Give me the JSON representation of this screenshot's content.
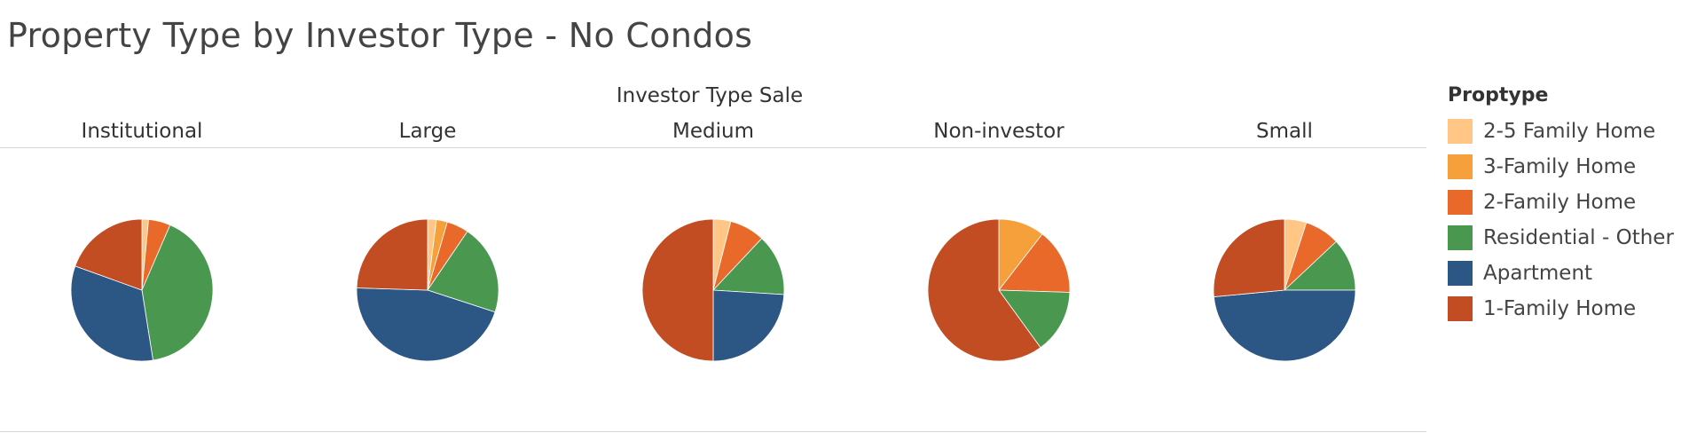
{
  "title": "Property Type by Investor Type - No Condos",
  "chart_data": {
    "type": "pie",
    "title": "Property Type by Investor Type - No Condos",
    "facet_label": "Investor Type Sale",
    "legend_title": "Proptype",
    "legend_position": "right",
    "categories": [
      "2-5 Family Home",
      "3-Family Home",
      "2-Family Home",
      "Residential - Other",
      "Apartment",
      "1-Family Home"
    ],
    "colors": [
      "#FFC685",
      "#F5A03A",
      "#E8692A",
      "#4A9850",
      "#2C5784",
      "#C34D23"
    ],
    "panels": [
      {
        "name": "Institutional",
        "values": [
          1.5,
          0,
          5,
          41,
          33,
          19.5
        ]
      },
      {
        "name": "Large",
        "values": [
          2,
          2.5,
          5,
          20.5,
          45.5,
          24.5
        ]
      },
      {
        "name": "Medium",
        "values": [
          4,
          0,
          8,
          14,
          24,
          50
        ]
      },
      {
        "name": "Non-investor",
        "values": [
          0,
          10.5,
          15,
          14.5,
          0,
          60
        ]
      },
      {
        "name": "Small",
        "values": [
          5,
          0,
          8,
          12,
          48.5,
          26.5
        ]
      }
    ]
  }
}
